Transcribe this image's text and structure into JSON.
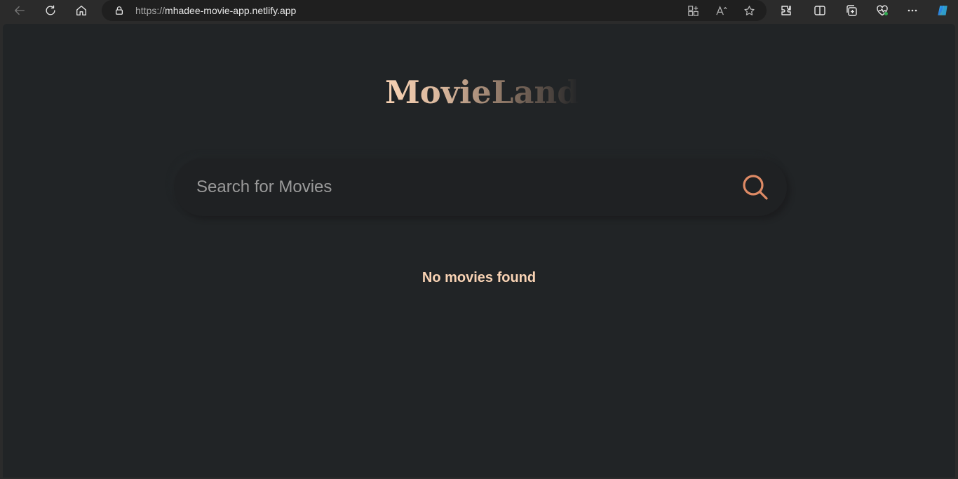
{
  "browser": {
    "url_scheme": "https://",
    "url_host": "mhadee-movie-app.netlify.app"
  },
  "app": {
    "title": "MovieLand",
    "search": {
      "placeholder": "Search for Movies",
      "value": ""
    },
    "empty_message": "No movies found"
  },
  "colors": {
    "background": "#212426",
    "accent": "#de8a65",
    "title_light": "#f9d3b4",
    "message": "#f9d3b4"
  },
  "icons": [
    "back-icon",
    "refresh-icon",
    "home-icon",
    "lock-icon",
    "app-available-icon",
    "read-aloud-icon",
    "favorite-star-icon",
    "extensions-icon",
    "split-screen-icon",
    "collections-icon",
    "browser-essentials-icon",
    "more-options-icon",
    "copilot-icon",
    "search-icon"
  ]
}
